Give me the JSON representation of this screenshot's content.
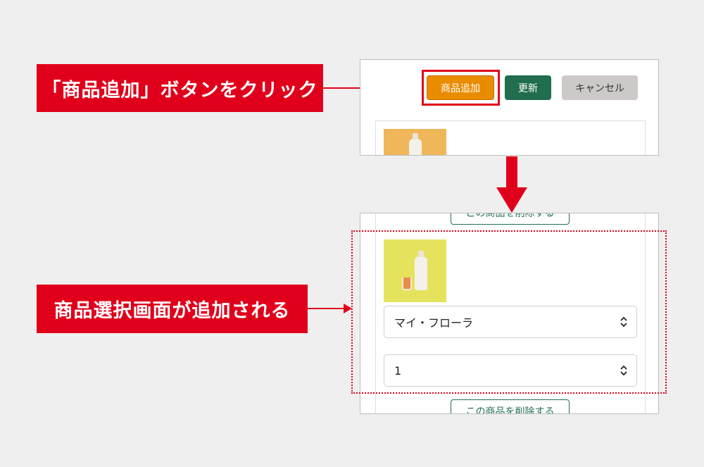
{
  "callouts": {
    "step1": "「商品追加」ボタンをクリック",
    "step2": "商品選択画面が追加される"
  },
  "top_panel": {
    "add_label": "商品追加",
    "update_label": "更新",
    "cancel_label": "キャンセル"
  },
  "bottom_panel": {
    "delete_label": "この商品を削除する",
    "product_select_value": "マイ・フローラ",
    "quantity_select_value": "1"
  },
  "colors": {
    "accent_red": "#e0001b",
    "add_button": "#ea8c00",
    "update_button": "#216e4e",
    "cancel_button": "#cdc9c9"
  },
  "icons": {
    "select_chevron": "chevron-up-down-icon",
    "arrow": "arrow-right-icon",
    "arrow_down": "arrow-down-icon"
  }
}
